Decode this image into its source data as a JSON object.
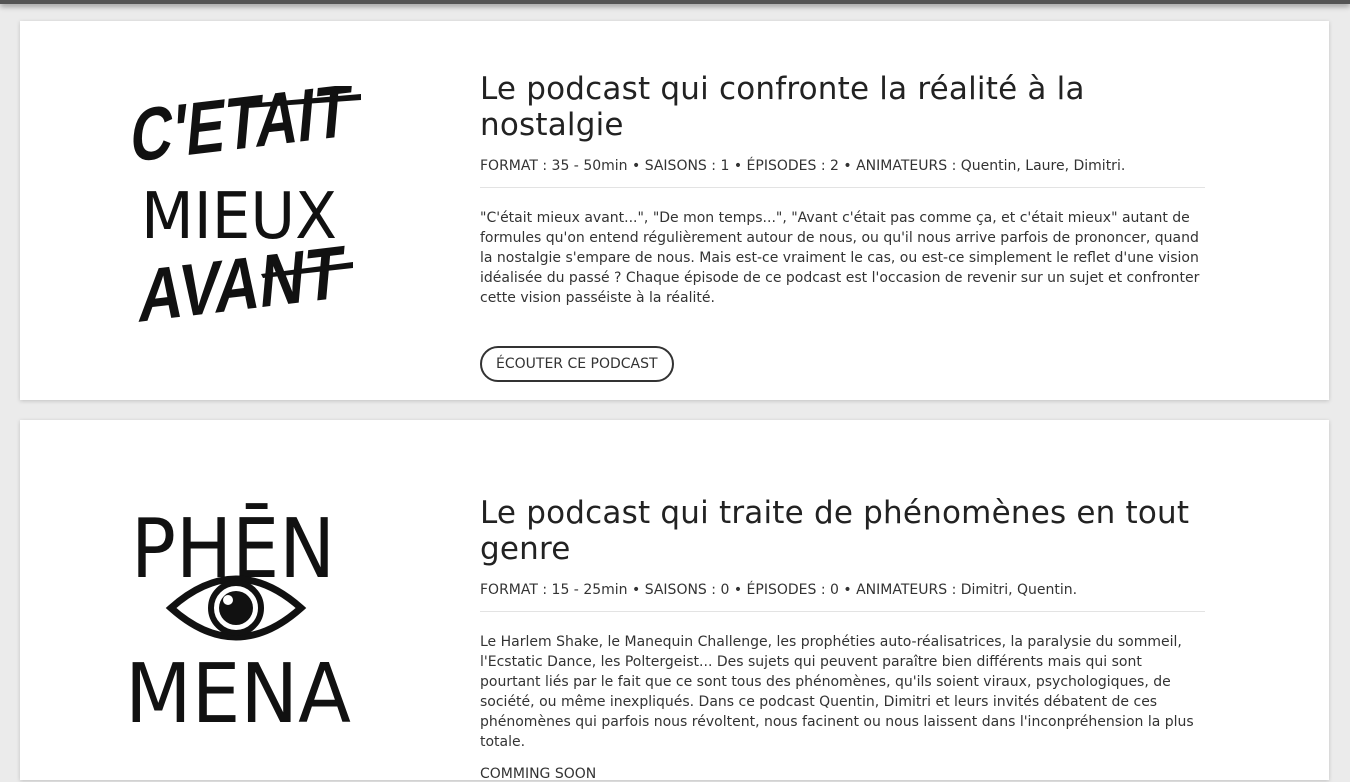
{
  "podcasts": [
    {
      "logo_text": [
        "C'ETAIT",
        "MIEUX",
        "AVANT"
      ],
      "title": "Le podcast qui confronte la réalité à la nostalgie",
      "meta": {
        "format_label": "FORMAT :",
        "format_value": "35 - 50min",
        "seasons_label": "SAISONS :",
        "seasons_value": "1",
        "episodes_label": "ÉPISODES :",
        "episodes_value": "2",
        "hosts_label": "ANIMATEURS :",
        "hosts_value": "Quentin, Laure, Dimitri."
      },
      "description": "\"C'était mieux avant...\", \"De mon temps...\", \"Avant c'était pas comme ça, et c'était mieux\" autant de formules qu'on entend régulièrement autour de nous, ou qu'il nous arrive parfois de prononcer, quand la nostalgie s'empare de nous. Mais est-ce vraiment le cas, ou est-ce simplement le reflet d'une vision idéalisée du passé ? Chaque épisode de ce podcast est l'occasion de revenir sur un sujet et confronter cette vision passéiste à la réalité.",
      "button_label": "ÉCOUTER CE PODCAST"
    },
    {
      "logo_text": [
        "PHĒN",
        "MENA"
      ],
      "title": "Le podcast qui traite de phénomènes en tout genre",
      "meta": {
        "format_label": "FORMAT :",
        "format_value": "15 - 25min",
        "seasons_label": "SAISONS :",
        "seasons_value": "0",
        "episodes_label": "ÉPISODES :",
        "episodes_value": "0",
        "hosts_label": "ANIMATEURS :",
        "hosts_value": "Dimitri, Quentin."
      },
      "description": "Le Harlem Shake, le Manequin Challenge, les prophéties auto-réalisatrices, la paralysie du sommeil, l'Ecstatic Dance, les Poltergeist... Des sujets qui peuvent paraître bien différents mais qui sont pourtant liés par le fait que ce sont tous des phénomènes, qu'ils soient viraux, psychologiques, de société, ou même inexpliqués. Dans ce podcast Quentin, Dimitri et leurs invités débatent de ces phénomènes qui parfois nous révoltent, nous facinent ou nous laissent dans l'inconpréhension la plus totale.",
      "status": "COMMING SOON"
    }
  ]
}
